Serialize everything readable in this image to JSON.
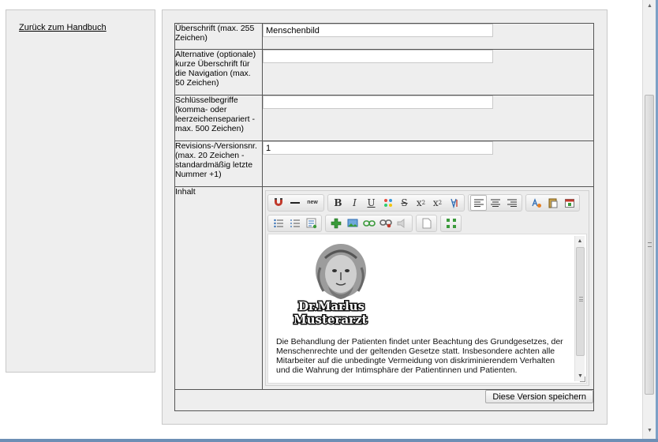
{
  "sidebar": {
    "back_link": "Zurück zum Handbuch"
  },
  "form": {
    "rows": [
      {
        "label": "Überschrift (max. 255 Zeichen)",
        "value": "Menschenbild"
      },
      {
        "label": "Alternative (optionale) kurze Überschrift für die Navigation (max. 50 Zeichen)",
        "value": ""
      },
      {
        "label": "Schlüsselbegriffe (komma- oder leerzeichensepariert - max. 500 Zeichen)",
        "value": ""
      },
      {
        "label": "Revisions-/Versionsnr. (max. 20 Zeichen - standardmäßig letzte Nummer +1)",
        "value": "1"
      }
    ],
    "content_label": "Inhalt",
    "save_label": "Diese Version speichern"
  },
  "editor": {
    "toolbar_new_label": "new",
    "logo_line1": "Dr.Marlus",
    "logo_line2": "Musterarzt",
    "body_text": "Die Behandlung der Patienten findet unter Beachtung des Grundgesetzes, der Menschenrechte und der geltenden Gesetze statt. Insbesondere achten alle Mitarbeiter auf die unbedingte Vermeidung von diskriminierendem Verhalten und die Wahrung der Intimsphäre der Patientinnen und Patienten."
  },
  "icons": {
    "accent_green": "#3a9a3a",
    "accent_red": "#c0392b",
    "accent_blue": "#2f6db5"
  }
}
